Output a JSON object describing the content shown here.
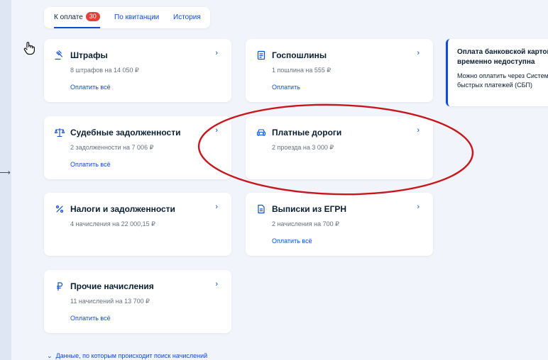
{
  "tabs": [
    {
      "label": "К оплате",
      "badge": "30"
    },
    {
      "label": "По квитанции"
    },
    {
      "label": "История"
    }
  ],
  "cards": {
    "fines": {
      "icon": "gavel-icon",
      "title": "Штрафы",
      "subtitle": "8 штрафов на 14 050 ₽",
      "link": "Оплатить всё"
    },
    "duties": {
      "icon": "document-list-icon",
      "title": "Госпошлины",
      "subtitle": "1 пошлина на 555 ₽",
      "link": "Оплатить"
    },
    "court_debts": {
      "icon": "scales-icon",
      "title": "Судебные задолженности",
      "subtitle": "2 задолженности на 7 006 ₽",
      "link": "Оплатить всё"
    },
    "toll_roads": {
      "icon": "car-icon",
      "title": "Платные дороги",
      "subtitle": "2 проезда на 3 000 ₽"
    },
    "taxes": {
      "icon": "percent-icon",
      "title": "Налоги и задолженности",
      "subtitle": "4 начисления на 22 000,15 ₽"
    },
    "egrn": {
      "icon": "document-icon",
      "title": "Выписки из ЕГРН",
      "subtitle": "2 начисления на 700 ₽",
      "link": "Оплатить всё"
    },
    "other": {
      "icon": "ruble-icon",
      "title": "Прочие начисления",
      "subtitle": "11 начислений на 13 700 ₽",
      "link": "Оплатить всё"
    }
  },
  "notice": {
    "title": "Оплата банковской картой временно недоступна",
    "text": "Можно оплатить через Систему быстрых платежей (СБП)"
  },
  "footer": {
    "toggle": "Данные, по которым происходит поиск начислений"
  },
  "colors": {
    "accent": "#0d4cd3",
    "badge": "#e0413e",
    "highlight": "#c8161d",
    "background": "#f1f4fa"
  }
}
